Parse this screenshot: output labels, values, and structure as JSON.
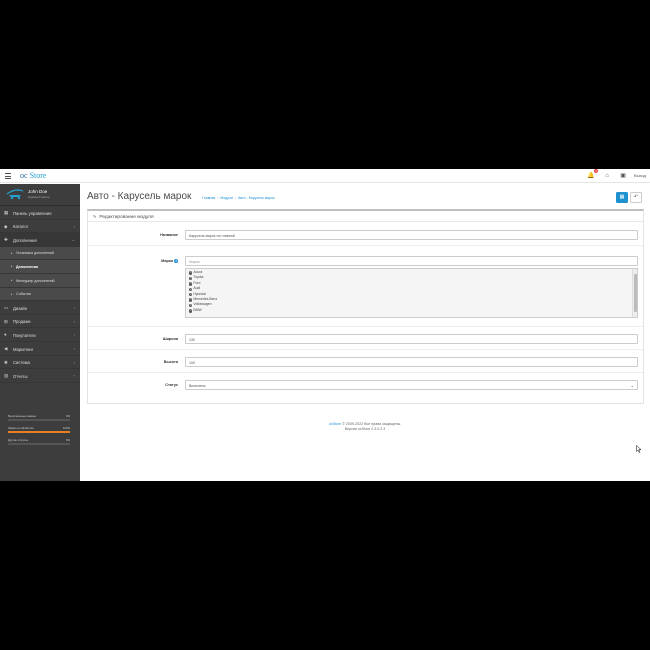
{
  "header": {
    "logo_prefix": "oc",
    "logo_brand": "Store",
    "notification_count": "1",
    "logout_label": "Выход"
  },
  "user": {
    "name": "John Doe",
    "role": "Администратор"
  },
  "sidebar": {
    "items": [
      {
        "label": "Панель управления",
        "icon": "dashboard-icon",
        "arrow": ""
      },
      {
        "label": "Каталог",
        "icon": "tag-icon",
        "arrow": "›"
      },
      {
        "label": "Дополнения",
        "icon": "puzzle-icon",
        "arrow": "⌄"
      },
      {
        "label": "Установка дополнений",
        "icon": "bullet-icon",
        "arrow": ""
      },
      {
        "label": "Дополнения",
        "icon": "bullet-icon",
        "arrow": ""
      },
      {
        "label": "Менеджер дополнений",
        "icon": "bullet-icon",
        "arrow": ""
      },
      {
        "label": "События",
        "icon": "bullet-icon",
        "arrow": ""
      },
      {
        "label": "Дизайн",
        "icon": "monitor-icon",
        "arrow": "›"
      },
      {
        "label": "Продажи",
        "icon": "cart-icon",
        "arrow": "›"
      },
      {
        "label": "Покупатели",
        "icon": "user-icon",
        "arrow": "›"
      },
      {
        "label": "Маркетинг",
        "icon": "share-icon",
        "arrow": "›"
      },
      {
        "label": "Система",
        "icon": "gear-icon",
        "arrow": "›"
      },
      {
        "label": "Отчеты",
        "icon": "chart-icon",
        "arrow": "›"
      }
    ],
    "stats": [
      {
        "label": "Выполненные заказы",
        "value": "0%",
        "fill": 0,
        "color": "#2ecc71"
      },
      {
        "label": "Заказы в обработке",
        "value": "100%",
        "fill": 1,
        "color": "#e67e22"
      },
      {
        "label": "Другие статусы",
        "value": "0%",
        "fill": 0,
        "color": "#e74c3c"
      }
    ]
  },
  "page": {
    "title": "Авто - Карусель марок",
    "breadcrumb": [
      "Главная",
      "Модули",
      "Авто - Карусель марок"
    ],
    "save_icon": "save-icon",
    "back_icon": "reply-icon"
  },
  "panel": {
    "heading": "Редактирование модуля",
    "fields": {
      "name_label": "Название",
      "name_value": "Карусель марок на главной",
      "brands_label": "Марки",
      "brands_placeholder": "Марки",
      "brands": [
        "Acura",
        "Toyota",
        "Ford",
        "Audi",
        "Hyundai",
        "Mercedes-Benz",
        "Volkswagen",
        "BMW"
      ],
      "width_label": "Ширина",
      "width_value": "130",
      "height_label": "Высота",
      "height_value": "100",
      "status_label": "Статус",
      "status_value": "Включено"
    }
  },
  "footer": {
    "link": "ocStore",
    "copyright": " © 2009-2022 Все права защищены.",
    "version": "Версия ocStore 2.3.0.2.3"
  }
}
